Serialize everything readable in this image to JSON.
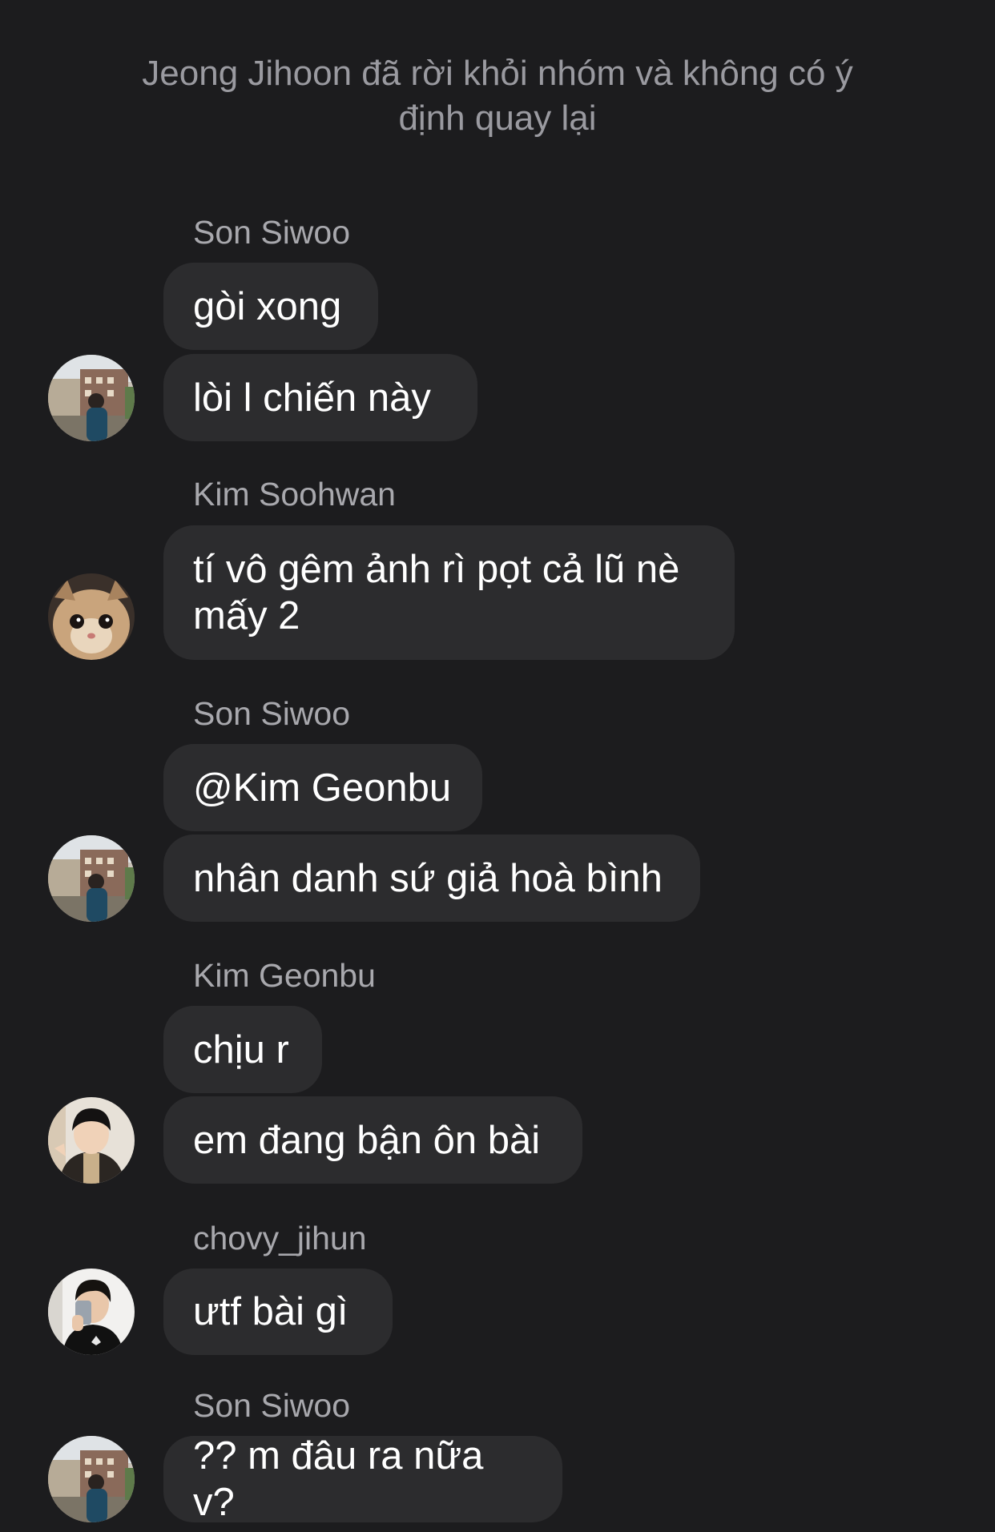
{
  "system_notice": "Jeong Jihoon đã rời khỏi nhóm và không có ý định quay lại",
  "messages": [
    {
      "sender": "Son Siwoo",
      "bubbles": [
        "gòi xong",
        "lòi l chiến này"
      ],
      "avatar": "building-photo-avatar"
    },
    {
      "sender": "Kim Soohwan",
      "bubbles": [
        "tí vô gêm ảnh rì pọt cả lũ nè mấy 2"
      ],
      "avatar": "cat-photo-avatar"
    },
    {
      "sender": "Son Siwoo",
      "bubbles": [
        "@Kim Geonbu",
        "nhân danh sứ giả hoà bình"
      ],
      "avatar": "building-photo-avatar"
    },
    {
      "sender": "Kim Geonbu",
      "bubbles": [
        "chịu r",
        "em đang bận ôn bài"
      ],
      "avatar": "person-photo-avatar"
    },
    {
      "sender": "chovy_jihun",
      "bubbles": [
        "ưtf bài gì"
      ],
      "avatar": "mirror-selfie-avatar"
    },
    {
      "sender": "Son Siwoo",
      "bubbles": [
        "?? m đâu ra nữa v?"
      ],
      "avatar": "building-photo-avatar"
    }
  ],
  "colors": {
    "background": "#1c1c1e",
    "bubble": "#2c2c2e",
    "text": "#ffffff",
    "muted": "#9a9aa0"
  }
}
